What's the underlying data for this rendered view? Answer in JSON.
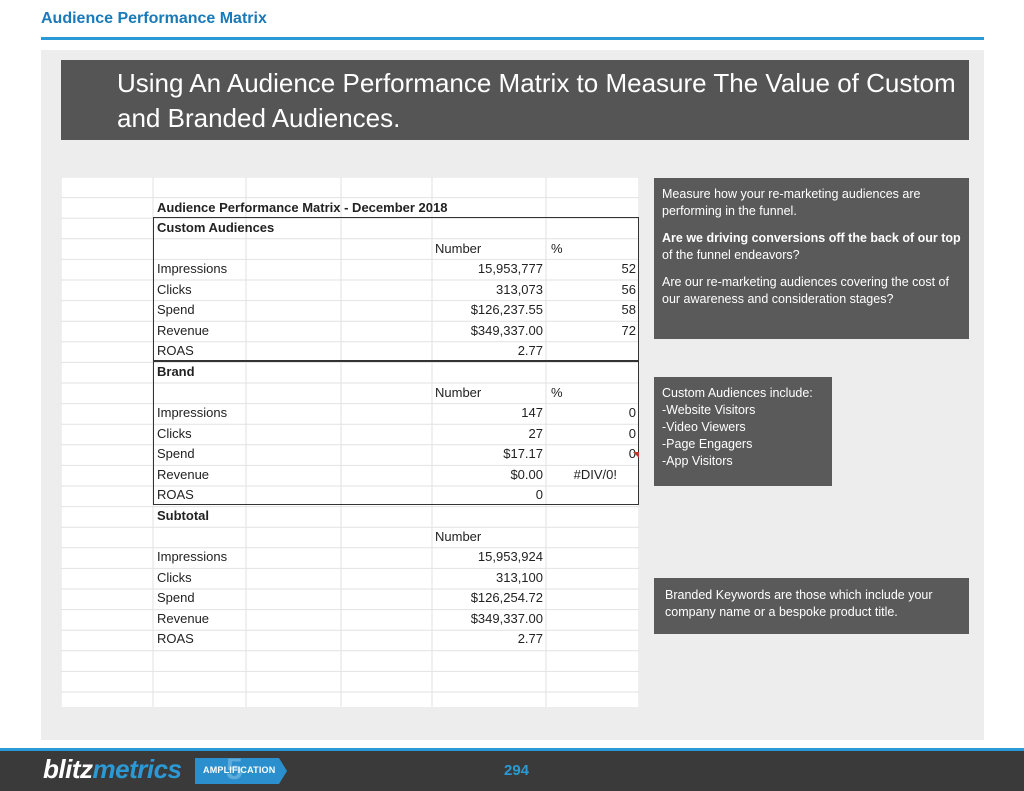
{
  "header": {
    "title": "Audience Performance Matrix"
  },
  "banner": {
    "title": "Using An Audience Performance Matrix to Measure The Value of Custom and Branded Audiences."
  },
  "sheet": {
    "title": "Audience Performance Matrix - December 2018",
    "number_header": "Number",
    "percent_header": "%",
    "custom": {
      "heading": "Custom Audiences",
      "rows": [
        {
          "label": "Impressions",
          "number": "15,953,777",
          "percent": "52"
        },
        {
          "label": "Clicks",
          "number": "313,073",
          "percent": "56"
        },
        {
          "label": "Spend",
          "number": "$126,237.55",
          "percent": "58"
        },
        {
          "label": "Revenue",
          "number": "$349,337.00",
          "percent": "72"
        },
        {
          "label": "ROAS",
          "number": "2.77",
          "percent": ""
        }
      ]
    },
    "brand": {
      "heading": "Brand",
      "rows": [
        {
          "label": "Impressions",
          "number": "147",
          "percent": "0"
        },
        {
          "label": "Clicks",
          "number": "27",
          "percent": "0"
        },
        {
          "label": "Spend",
          "number": "$17.17",
          "percent": "0"
        },
        {
          "label": "Revenue",
          "number": "$0.00",
          "percent": "#DIV/0!"
        },
        {
          "label": "ROAS",
          "number": "0",
          "percent": ""
        }
      ]
    },
    "subtotal": {
      "heading": "Subtotal",
      "rows": [
        {
          "label": "Impressions",
          "number": "15,953,924"
        },
        {
          "label": "Clicks",
          "number": "313,100"
        },
        {
          "label": "Spend",
          "number": "$126,254.72"
        },
        {
          "label": "Revenue",
          "number": "$349,337.00"
        },
        {
          "label": "ROAS",
          "number": "2.77"
        }
      ]
    }
  },
  "info1": {
    "p1": "Measure how your re-marketing audiences are performing in the funnel.",
    "p2": "Are we driving conversions off the back of our top",
    "p2b": "of the funnel endeavors?",
    "p3": "Are our re-marketing audiences covering the cost of our awareness and consideration stages?"
  },
  "info2": {
    "lines": [
      "Custom Audiences include:",
      "-Website Visitors",
      "-Video Viewers",
      "-Page Engagers",
      "-App Visitors"
    ]
  },
  "info3": {
    "text": "Branded Keywords are those which include your company name or a bespoke product title."
  },
  "footer": {
    "brand_a": "blitz",
    "brand_b": "metrics",
    "badge": "AMPLIFICATION",
    "badge_number": "5",
    "page": "294"
  },
  "colors": {
    "accent": "#2a9ad6",
    "banner": "#555555",
    "info_box": "#5a5a5a",
    "facebook": "#3b5998"
  }
}
